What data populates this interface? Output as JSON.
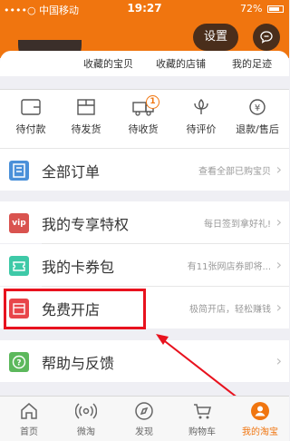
{
  "status_bar": {
    "carrier": "••••○ 中国移动",
    "time": "19:27",
    "battery": "72%"
  },
  "header": {
    "settings_label": "设置"
  },
  "favorites": {
    "items": [
      "收藏的宝贝",
      "收藏的店铺",
      "我的足迹"
    ]
  },
  "orders": {
    "items": [
      {
        "label": "待付款"
      },
      {
        "label": "待发货"
      },
      {
        "label": "待收货",
        "badge": "1"
      },
      {
        "label": "待评价"
      },
      {
        "label": "退款/售后"
      }
    ]
  },
  "menu": {
    "all_orders": {
      "title": "全部订单",
      "sub": "查看全部已购宝贝"
    },
    "vip": {
      "icon_text": "vip",
      "title": "我的专享特权",
      "sub": "每日签到拿好礼!"
    },
    "coupons": {
      "title": "我的卡券包",
      "sub": "有11张网店券即将..."
    },
    "open_shop": {
      "title": "免费开店",
      "sub": "极简开店，轻松赚钱"
    },
    "help": {
      "title": "帮助与反馈"
    },
    "chevron": "›"
  },
  "tabbar": {
    "items": [
      {
        "label": "首页"
      },
      {
        "label": "微淘"
      },
      {
        "label": "发现"
      },
      {
        "label": "购物车"
      },
      {
        "label": "我的淘宝"
      }
    ]
  },
  "colors": {
    "brand": "#f0750f",
    "highlight": "#e8121e"
  }
}
